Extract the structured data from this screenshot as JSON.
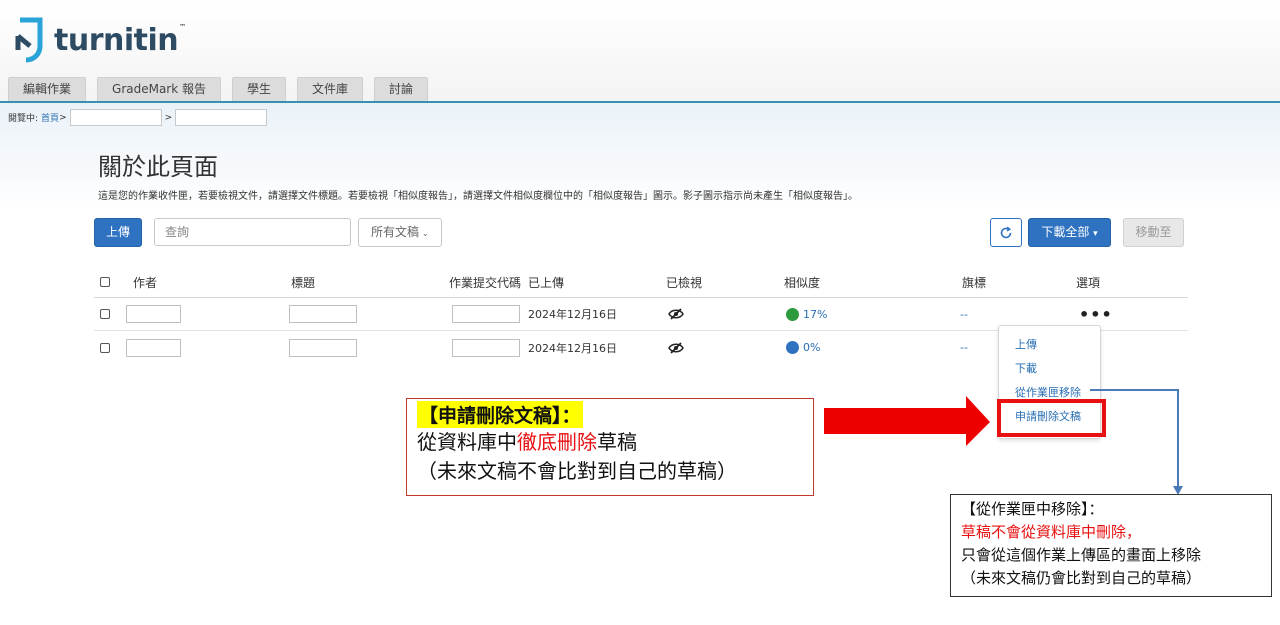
{
  "brand": {
    "logo_text": "turnitin",
    "logo_tm": "™"
  },
  "tabs": [
    {
      "label": "編輯作業"
    },
    {
      "label": "GradeMark 報告"
    },
    {
      "label": "學生"
    },
    {
      "label": "文件庫"
    },
    {
      "label": "討論"
    }
  ],
  "breadcrumb": {
    "prefix": "閱覽中:",
    "home": "首頁",
    "sep1": ">",
    "sep2": ">"
  },
  "page": {
    "title": "關於此頁面",
    "description": "這是您的作業收件匣，若要檢視文件，請選擇文件標題。若要檢視「相似度報告」，請選擇文件相似度欄位中的「相似度報告」圖示。影子圖示指示尚未產生「相似度報告」。"
  },
  "toolbar": {
    "upload_label": "上傳",
    "search_placeholder": "查詢",
    "filter_label": "所有文稿",
    "filter_caret": "⌄",
    "download_label": "下載全部",
    "download_caret": "▾",
    "move_label": "移動至"
  },
  "table": {
    "headers": {
      "author": "作者",
      "title": "標題",
      "submission_id": "作業提交代碼",
      "uploaded": "已上傳",
      "viewed": "已檢視",
      "similarity": "相似度",
      "flag": "旗標",
      "options": "選項"
    },
    "rows": [
      {
        "uploaded": "2024年12月16日",
        "similarity": "17%",
        "similarity_color": "#2e9a3e",
        "flag": "--",
        "options": "•••"
      },
      {
        "uploaded": "2024年12月16日",
        "similarity": "0%",
        "similarity_color": "#2e72c1",
        "flag": "--"
      }
    ]
  },
  "options_menu": {
    "items": [
      {
        "label": "上傳"
      },
      {
        "label": "下載"
      },
      {
        "label": "從作業匣移除"
      },
      {
        "label": "申請刪除文稿"
      }
    ]
  },
  "annotation_left": {
    "title": "【申請刪除文稿】：",
    "line1_a": "從資料庫中",
    "line1_red": "徹底刪除",
    "line1_b": "草稿",
    "line2": "（未來文稿不會比對到自己的草稿）"
  },
  "annotation_right": {
    "title": "【從作業匣中移除】：",
    "line1_red": "草稿不會從資料庫中刪除，",
    "line2": "只會從這個作業上傳區的畫面上移除",
    "line3": "（未來文稿仍會比對到自己的草稿）"
  },
  "colors": {
    "primary": "#2e72c1",
    "header_line": "#3a8fb4",
    "annotation_red": "#e81010",
    "highlight_yellow": "#ffff00",
    "connector_blue": "#4a7ab8"
  }
}
